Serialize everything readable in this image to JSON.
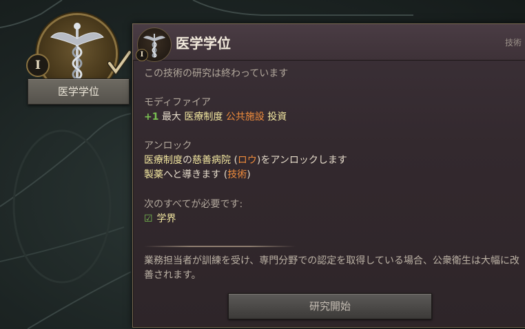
{
  "tech_node": {
    "tier": "I",
    "label": "医学学位",
    "icon": "caduceus-icon",
    "researched": true
  },
  "tooltip": {
    "title": "医学学位",
    "tier": "I",
    "category": "技術",
    "status": "この技術の研究は終わっています",
    "modifier_section": {
      "title": "モディファイア",
      "value": "+1",
      "word1": "最大",
      "word2": "医療制度",
      "word3": "公共施設",
      "word4": "投資"
    },
    "unlock_section": {
      "title": "アンロック",
      "line1_part1": "医療制度",
      "line1_part2": "の",
      "line1_part3": "慈善病院",
      "line1_paren_open": " (",
      "line1_part4": "ロウ",
      "line1_paren_close": ")",
      "line1_part5": "をアンロックします",
      "line2_part1": "製薬",
      "line2_part2": "へと導きます (",
      "line2_part3": "技術",
      "line2_part4": ")"
    },
    "requirements": {
      "title": "次のすべてが必要です:",
      "items": [
        {
          "label": "学界",
          "met": true
        }
      ]
    },
    "flavor_text": "業務担当者が訓練を受け、専門分野での認定を取得している場合、公衆衛生は大幅に改善されます。",
    "button_label": "研究開始"
  },
  "colors": {
    "positive": "#7ac052",
    "highlight_orange": "#f08c3c",
    "highlight_yellow": "#f2e6a0",
    "panel_bg": "#33292e"
  }
}
